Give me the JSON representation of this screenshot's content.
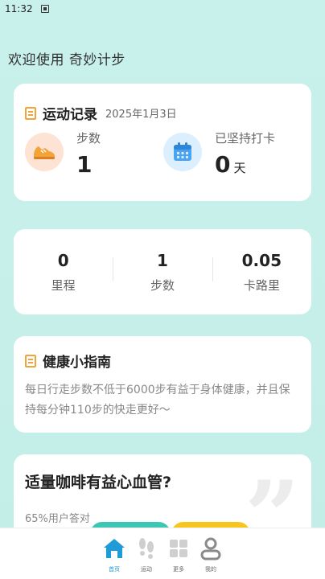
{
  "status_bar": {
    "time": "11:32"
  },
  "welcome_text": "欢迎使用 奇妙计步",
  "record_card": {
    "title": "运动记录",
    "date": "2025年1月3日",
    "steps": {
      "label": "步数",
      "value": "1",
      "icon": "sneaker-icon"
    },
    "streak": {
      "label": "已坚持打卡",
      "value": "0",
      "unit": "天",
      "icon": "calendar-icon"
    }
  },
  "metrics": [
    {
      "value": "0",
      "label": "里程"
    },
    {
      "value": "1",
      "label": "步数"
    },
    {
      "value": "0.05",
      "label": "卡路里"
    }
  ],
  "guide_card": {
    "title": "健康小指南",
    "text": "每日行走步数不低于6000步有益于身体健康，并且保持每分钟110步的快走更好～"
  },
  "quiz_card": {
    "title": "适量咖啡有益心血管?",
    "subtitle": "65%用户答对"
  },
  "bottom_nav": [
    {
      "label": "首页",
      "icon": "home-icon",
      "active": true
    },
    {
      "label": "运动",
      "icon": "footprints-icon",
      "active": false
    },
    {
      "label": "更多",
      "icon": "grid-icon",
      "active": false
    },
    {
      "label": "我的",
      "icon": "user-icon",
      "active": false
    }
  ],
  "colors": {
    "background": "#c9f1ec",
    "accent_orange": "#f2a43a",
    "nav_active": "#1f9bd7",
    "quiz_option_a": "#3ec6b5",
    "quiz_option_b": "#f7c61e"
  }
}
